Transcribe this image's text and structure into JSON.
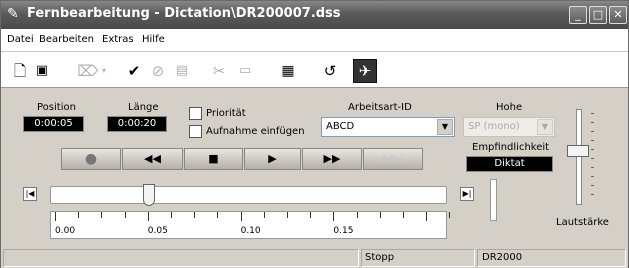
{
  "window": {
    "title": "Fernbearbeitung - Dictation\\DR200007.dss",
    "icon": "pen-icon"
  },
  "menu": {
    "items": [
      "Datei",
      "Bearbeiten",
      "Extras",
      "Hilfe"
    ]
  },
  "toolbar": {
    "buttons": [
      "new-document",
      "save",
      "eraser",
      "check",
      "cancel-check",
      "book",
      "scissors",
      "transcription",
      "properties",
      "undo",
      "wizard"
    ]
  },
  "fields": {
    "position_label": "Position",
    "position_value": "0:00:05",
    "length_label": "Länge",
    "length_value": "0:00:20",
    "priority_label": "Priorität",
    "priority_checked": false,
    "insert_label": "Aufnahme einfügen",
    "insert_checked": false,
    "worktype_label": "Arbeitsart-ID",
    "worktype_value": "ABCD",
    "quality_label": "Hohe",
    "quality_value": "SP (mono)",
    "sensitivity_label": "Empfindlichkeit",
    "sensitivity_value": "Diktat",
    "volume_label": "Lautstärke"
  },
  "transport": {
    "buttons": [
      "record",
      "rewind",
      "stop",
      "play",
      "fast-forward",
      "skip-forward"
    ]
  },
  "timeline": {
    "ticks": [
      "0.00",
      "0.05",
      "0.10",
      "0.15"
    ],
    "position_fraction": 0.25
  },
  "status": {
    "state": "Stopp",
    "device": "DR2000"
  }
}
